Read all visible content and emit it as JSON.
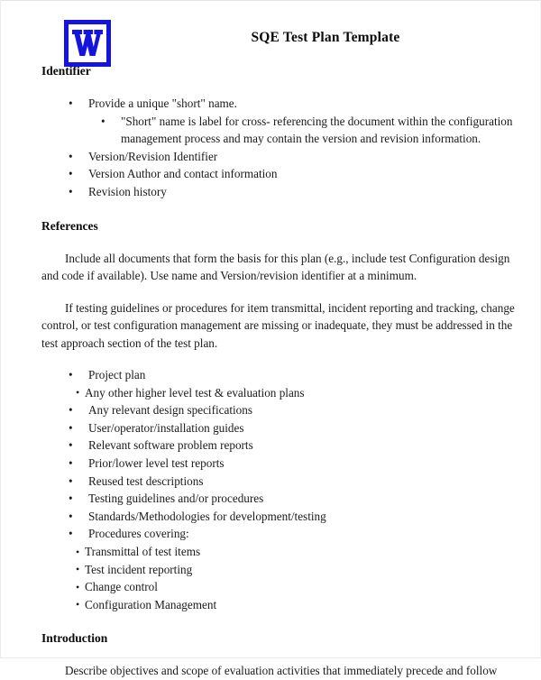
{
  "document": {
    "title": "SQE Test Plan Template",
    "logo": {
      "icon_name": "word-document-icon",
      "letter": "W",
      "color": "#1414e0",
      "background": "#ffffff"
    }
  },
  "sections": {
    "identifier": {
      "heading": "Identifier",
      "bullets": [
        "Provide a unique \"short\" name.",
        "Version/Revision Identifier",
        " Version Author and contact information",
        "Revision history"
      ],
      "sub_bullet": "\"Short\" name is label for cross- referencing the document within the configuration management process and may contain the version and revision information."
    },
    "references": {
      "heading": "References",
      "paragraph_1": "Include all documents that form the basis for this plan (e.g., include test Configuration design and code if available).  Use name and Version/revision identifier at a minimum.",
      "paragraph_2": "If testing guidelines or procedures for item transmittal, incident reporting and tracking, change control, or test configuration management are missing or inadequate, they must be addressed in the test approach section of the test plan.",
      "bullets": [
        "Project plan",
        "Any relevant design specifications",
        "User/operator/installation guides",
        "Relevant software problem reports",
        "Prior/lower level test reports",
        "Reused test descriptions",
        "Testing guidelines and/or procedures",
        "Standards/Methodologies for development/testing",
        "Procedures covering:"
      ],
      "tight_bullet_after_project_plan": "Any other higher level test & evaluation plans",
      "procedures_sub_bullets": [
        "Transmittal of test items",
        "Test incident reporting",
        "Change control",
        "Configuration Management"
      ]
    },
    "introduction": {
      "heading": "Introduction",
      "paragraph_1": "Describe objectives and scope of evaluation activities that immediately precede and follow"
    }
  },
  "glyphs": {
    "bullet": "•"
  }
}
